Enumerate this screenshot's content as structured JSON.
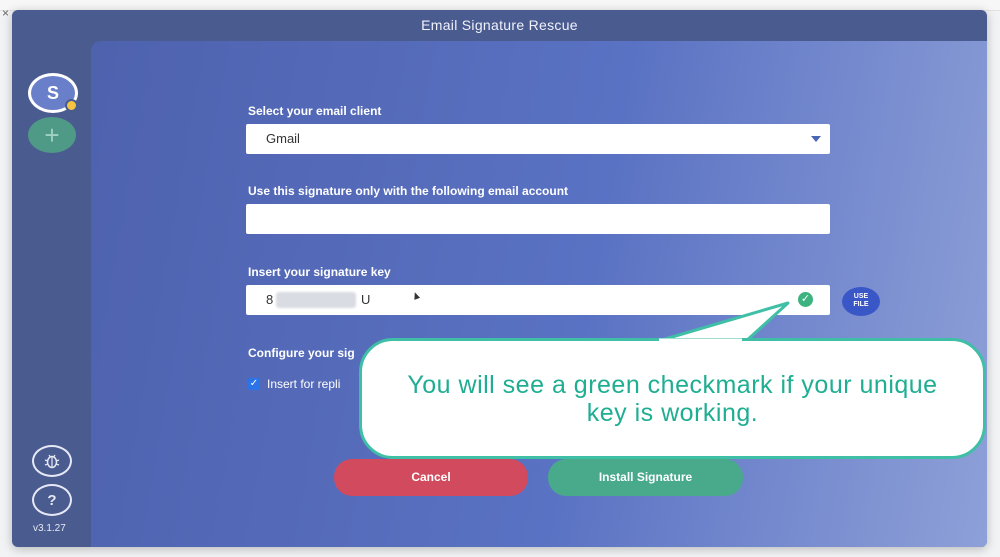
{
  "window": {
    "title": "Email Signature Rescue"
  },
  "sidebar": {
    "avatar_letter": "S",
    "add_symbol": "+",
    "help_symbol": "?",
    "version": "v3.1.27"
  },
  "form": {
    "client_label": "Select your email client",
    "client_value": "Gmail",
    "account_label": "Use this signature only with the following email account",
    "account_value": "",
    "key_label": "Insert your signature key",
    "key_first": "8",
    "key_last": "U",
    "use_file_label_1": "USE",
    "use_file_label_2": "FILE",
    "config_label": "Configure your sig",
    "insert_replies_label": "Insert for repli",
    "insert_replies_checked": true
  },
  "buttons": {
    "cancel": "Cancel",
    "install": "Install Signature"
  },
  "callout": {
    "text": "You will see a green checkmark if your unique key is working."
  },
  "colors": {
    "accent_green": "#3fb37f",
    "cancel_red": "#d14a5e",
    "install_green": "#49a98b",
    "callout_border": "#3fbfa6"
  }
}
